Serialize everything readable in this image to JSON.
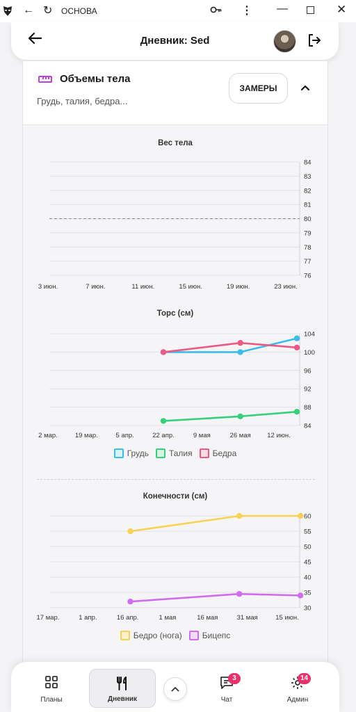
{
  "browser": {
    "title": "ОСНОВА",
    "logo_icon": "mask-icon",
    "back_icon": "arrow-left-icon",
    "reload_icon": "reload-icon",
    "key_icon": "key-icon",
    "menu_icon": "vertical-dots-icon"
  },
  "header": {
    "title": "Дневник: Sed"
  },
  "section": {
    "title": "Объемы тела",
    "subtitle": "Грудь, талия, бедра...",
    "measures_button": "ЗАМЕРЫ",
    "accent_color": "#c040d8"
  },
  "charts": {
    "weight_title": "Вес тела",
    "torso_title": "Торс (см)",
    "limbs_title": "Конечности (см)",
    "torso_legend": [
      "Грудь",
      "Талия",
      "Бедра"
    ],
    "limbs_legend": [
      "Бедро (нога)",
      "Бицепс"
    ]
  },
  "nav": {
    "plans": "Планы",
    "diary": "Дневник",
    "chat": "Чат",
    "chat_badge": "3",
    "admin": "Админ",
    "admin_badge": "14"
  },
  "chart_data": [
    {
      "type": "line",
      "title": "Вес тела",
      "x_ticks": [
        "3 июн.",
        "7 июн.",
        "11 июн.",
        "15 июн.",
        "19 июн.",
        "23 июн."
      ],
      "y_ticks": [
        76,
        77,
        78,
        79,
        80,
        81,
        82,
        83,
        84
      ],
      "ylim": [
        76,
        84
      ],
      "reference_line": 80,
      "series": [],
      "grid": true
    },
    {
      "type": "line",
      "title": "Торс (см)",
      "x_ticks": [
        "2 мар.",
        "19 мар.",
        "5 апр.",
        "22 апр.",
        "9 мая",
        "26 мая",
        "12 июн."
      ],
      "y_ticks": [
        84,
        88,
        92,
        96,
        100,
        104
      ],
      "ylim": [
        84,
        104
      ],
      "series": [
        {
          "name": "Грудь",
          "color": "#3cbcec",
          "points": [
            {
              "x": "2024-04-22",
              "y": 100
            },
            {
              "x": "2024-05-26",
              "y": 100
            },
            {
              "x": "2024-06-20",
              "y": 103
            }
          ]
        },
        {
          "name": "Талия",
          "color": "#34d07a",
          "points": [
            {
              "x": "2024-04-22",
              "y": 85
            },
            {
              "x": "2024-05-26",
              "y": 86
            },
            {
              "x": "2024-06-20",
              "y": 87
            }
          ]
        },
        {
          "name": "Бедра",
          "color": "#ec5a84",
          "points": [
            {
              "x": "2024-04-22",
              "y": 100
            },
            {
              "x": "2024-05-26",
              "y": 102
            },
            {
              "x": "2024-06-20",
              "y": 101
            }
          ]
        }
      ],
      "legend": "bottom",
      "grid": true
    },
    {
      "type": "line",
      "title": "Конечности (см)",
      "x_ticks": [
        "17 мар.",
        "1 апр.",
        "16 апр.",
        "1 мая",
        "16 мая",
        "31 мая",
        "15 июн."
      ],
      "y_ticks": [
        30,
        35,
        40,
        45,
        50,
        55,
        60
      ],
      "ylim": [
        30,
        60
      ],
      "series": [
        {
          "name": "Бедро (нога)",
          "color": "#f8d252",
          "points": [
            {
              "x": "2024-04-17",
              "y": 55
            },
            {
              "x": "2024-05-28",
              "y": 60
            },
            {
              "x": "2024-06-20",
              "y": 60
            }
          ]
        },
        {
          "name": "Бицепс",
          "color": "#d06cf0",
          "points": [
            {
              "x": "2024-04-17",
              "y": 32
            },
            {
              "x": "2024-05-28",
              "y": 34.5
            },
            {
              "x": "2024-06-20",
              "y": 34
            }
          ]
        }
      ],
      "legend": "bottom",
      "grid": true
    }
  ]
}
